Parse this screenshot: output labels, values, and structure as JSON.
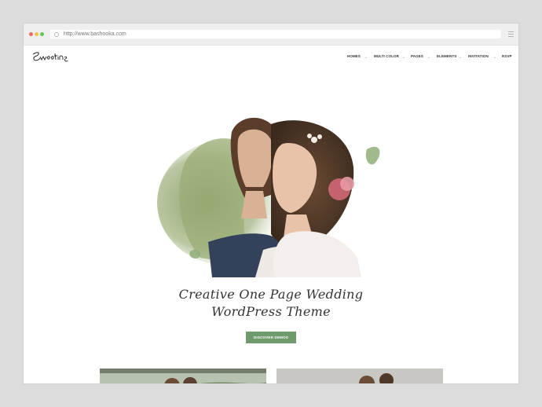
{
  "browser": {
    "url": "http://www.bashooka.com"
  },
  "site": {
    "logo_text": "Sweeting",
    "nav": [
      {
        "label": "HOMES",
        "has_dropdown": true
      },
      {
        "label": "MULTI COLOR",
        "has_dropdown": true
      },
      {
        "label": "PAGES",
        "has_dropdown": true
      },
      {
        "label": "ELEMENTS",
        "has_dropdown": true
      },
      {
        "label": "INVITATION",
        "has_dropdown": true
      },
      {
        "label": "RSVP",
        "has_dropdown": false
      }
    ],
    "headline_line1": "Creative One Page Wedding",
    "headline_line2": "WordPress Theme",
    "cta_label": "DISCOVER DEMOS"
  },
  "colors": {
    "accent": "#6f9a6c",
    "page_bg": "#dcdcdc",
    "chrome_bg": "#efefef",
    "dot_red": "#ed6b5e",
    "dot_yellow": "#f5bf4f",
    "dot_green": "#62c554"
  },
  "icons": {
    "url_icon": "globe-icon",
    "browser_menu": "hamburger-icon",
    "dropdown": "chevron-down-icon"
  }
}
